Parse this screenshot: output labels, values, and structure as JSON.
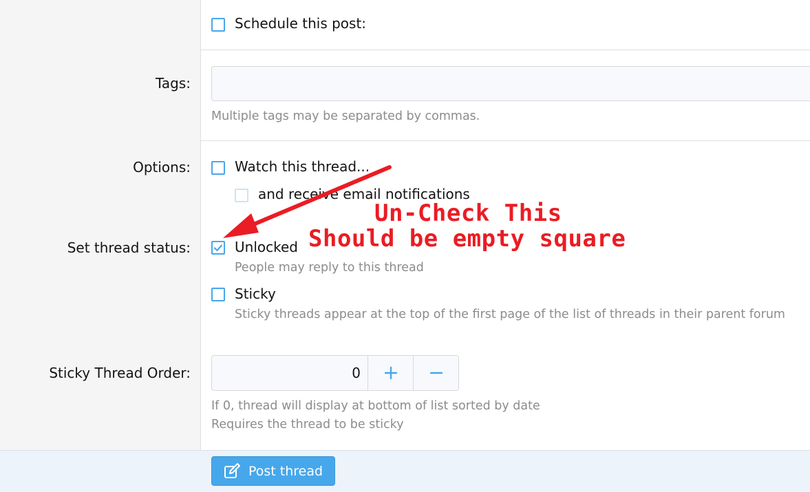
{
  "schedule": {
    "label": "Schedule this post:",
    "checked": false
  },
  "tags": {
    "label": "Tags:",
    "value": "",
    "placeholder": "",
    "hint": "Multiple tags may be separated by commas."
  },
  "options": {
    "label": "Options:",
    "watch": {
      "label": "Watch this thread...",
      "checked": false
    },
    "email": {
      "label": "and receive email notifications",
      "checked": false,
      "disabled": true
    }
  },
  "thread_status": {
    "label": "Set thread status:",
    "unlocked": {
      "label": "Unlocked",
      "hint": "People may reply to this thread",
      "checked": true
    },
    "sticky": {
      "label": "Sticky",
      "hint": "Sticky threads appear at the top of the first page of the list of threads in their parent forum",
      "checked": false
    }
  },
  "sticky_order": {
    "label": "Sticky Thread Order:",
    "value": "0",
    "increment_icon": "plus-icon",
    "decrement_icon": "minus-icon",
    "hint_1": "If 0, thread will display at bottom of list sorted by date",
    "hint_2": "Requires the thread to be sticky"
  },
  "footer": {
    "post_label": "Post thread",
    "post_icon": "edit-icon"
  },
  "annotation": {
    "line_1": "Un-Check This",
    "line_2": "Should be empty square",
    "color": "#ea1c24"
  },
  "colors": {
    "accent": "#47a7eb",
    "label_panel": "#f5f5f5",
    "hint_text": "#8c8c8c"
  }
}
